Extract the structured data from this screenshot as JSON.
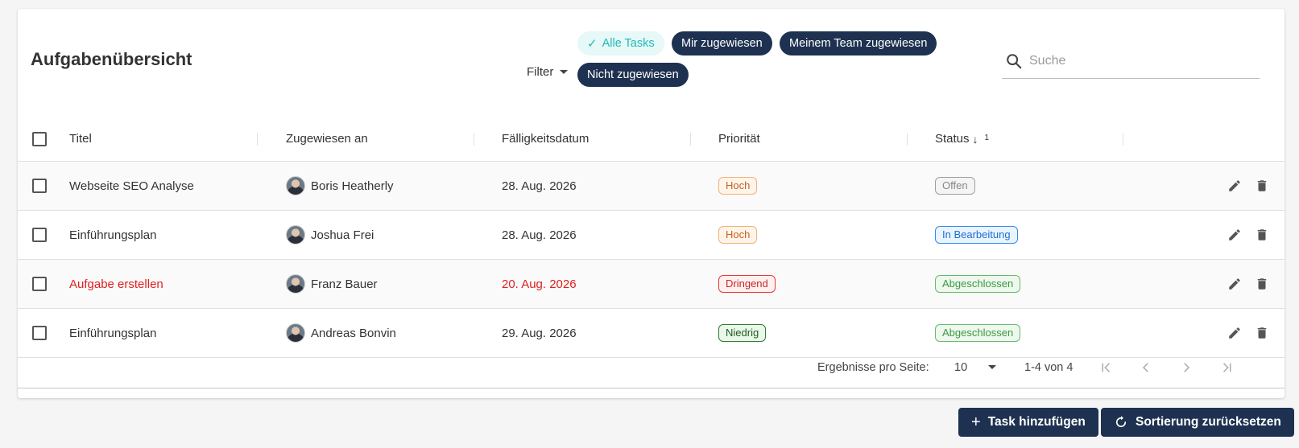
{
  "header": {
    "title": "Aufgabenübersicht",
    "filter_label": "Filter",
    "search_placeholder": "Suche",
    "chips": [
      {
        "label": "Alle Tasks",
        "selected": true
      },
      {
        "label": "Mir zugewiesen",
        "selected": false
      },
      {
        "label": "Meinem Team zugewiesen",
        "selected": false
      },
      {
        "label": "Nicht zugewiesen",
        "selected": false
      }
    ]
  },
  "table": {
    "columns": {
      "title": "Titel",
      "assignee": "Zugewiesen an",
      "due": "Fälligkeitsdatum",
      "priority": "Priorität",
      "status": "Status",
      "status_sort_arrow": "↓",
      "status_sort_order": "1"
    },
    "rows": [
      {
        "title": "Webseite SEO Analyse",
        "assignee": "Boris Heatherly",
        "due": "28. Aug. 2026",
        "priority": "Hoch",
        "status": "Offen",
        "urgent": false
      },
      {
        "title": "Einführungsplan",
        "assignee": "Joshua Frei",
        "due": "28. Aug. 2026",
        "priority": "Hoch",
        "status": "In Bearbeitung",
        "urgent": false
      },
      {
        "title": "Aufgabe erstellen",
        "assignee": "Franz Bauer",
        "due": "20. Aug. 2026",
        "priority": "Dringend",
        "status": "Abgeschlossen",
        "urgent": true
      },
      {
        "title": "Einführungsplan",
        "assignee": "Andreas Bonvin",
        "due": "29. Aug. 2026",
        "priority": "Niedrig",
        "status": "Abgeschlossen",
        "urgent": false
      }
    ]
  },
  "paginator": {
    "label": "Ergebnisse pro Seite:",
    "page_size": "10",
    "range": "1-4 von 4"
  },
  "footer": {
    "add_label": "Task hinzufügen",
    "reset_label": "Sortierung zurücksetzen"
  },
  "colors": {
    "primary": "#1e3150",
    "accent": "#22b9b9",
    "urgent": "#e0201f"
  }
}
